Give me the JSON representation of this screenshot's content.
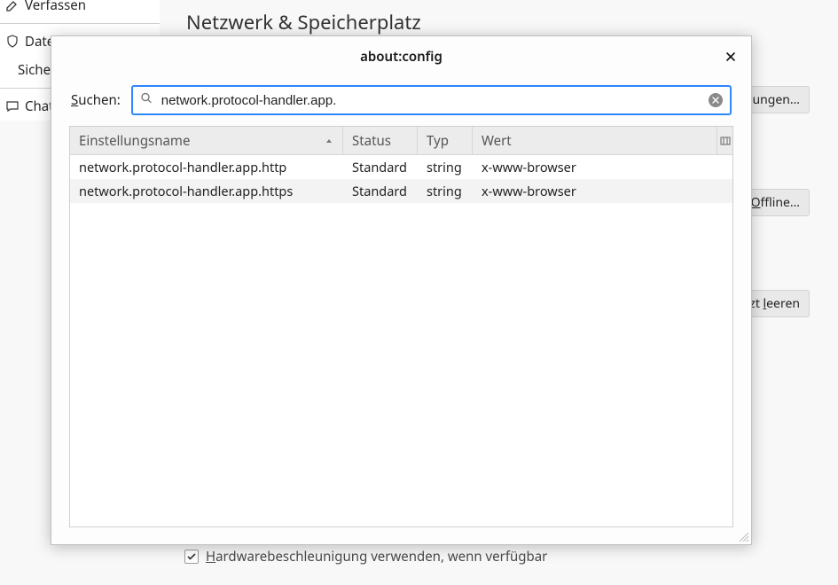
{
  "background": {
    "heading": "Netzwerk & Speicherplatz",
    "sidebar": {
      "items": [
        {
          "label": "Verfassen"
        },
        {
          "label": "Daten"
        },
        {
          "label_sub": "Siche"
        },
        {
          "label": "Chat"
        }
      ]
    },
    "buttons": {
      "btn1": "lungen…",
      "btn2": "Offline…",
      "btn3": "zt leeren"
    },
    "checkbox": {
      "label_prefix": "H",
      "label_rest": "ardwarebeschleunigung verwenden, wenn verfügbar"
    }
  },
  "dialog": {
    "title": "about:config",
    "search": {
      "label_prefix": "S",
      "label_rest": "uchen:",
      "value": "network.protocol-handler.app."
    },
    "columns": {
      "name": "Einstellungsname",
      "status": "Status",
      "type": "Typ",
      "value": "Wert"
    },
    "rows": [
      {
        "name": "network.protocol-handler.app.http",
        "status": "Standard",
        "type": "string",
        "value": "x-www-browser"
      },
      {
        "name": "network.protocol-handler.app.https",
        "status": "Standard",
        "type": "string",
        "value": "x-www-browser"
      }
    ]
  }
}
